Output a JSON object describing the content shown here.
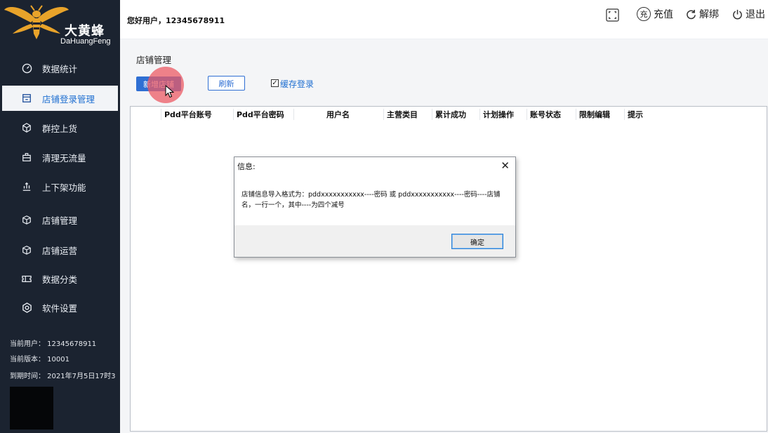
{
  "brand": {
    "name_cn": "大黄蜂",
    "name_en": "DaHuangFeng"
  },
  "sidebar": {
    "items": [
      {
        "label": "数据统计",
        "icon": "dashboard-icon",
        "active": false
      },
      {
        "label": "店铺登录管理",
        "icon": "store-icon",
        "active": true
      },
      {
        "label": "群控上货",
        "icon": "cube-icon",
        "active": false
      },
      {
        "label": "清理无流量",
        "icon": "briefcase-icon",
        "active": false
      },
      {
        "label": "上下架功能",
        "icon": "upload-chart-icon",
        "active": false
      },
      {
        "label": "店铺管理",
        "icon": "box-icon",
        "active": false
      },
      {
        "label": "店铺运营",
        "icon": "box-icon",
        "active": false
      },
      {
        "label": "数据分类",
        "icon": "ticket-icon",
        "active": false
      },
      {
        "label": "软件设置",
        "icon": "settings-hex-icon",
        "active": false
      }
    ],
    "current_user": "当前用户：  12345678911",
    "current_version": "当前版本：  10001",
    "expiry": "到期时间：  2021年7月5日17时3"
  },
  "header": {
    "greeting": "您好用户，12345678911",
    "recharge_label": "充值",
    "recharge_icon_char": "充",
    "unbind_label": "解绑",
    "logout_label": "退出"
  },
  "main": {
    "section_title": "店铺管理",
    "add_store_label": "新增店铺",
    "refresh_label": "刷新",
    "cache_login_label": "缓存登录",
    "cache_login_checked": true,
    "table_headers": [
      "Pdd平台账号",
      "Pdd平台密码",
      "用户名",
      "主营类目",
      "累计成功",
      "计划操作",
      "账号状态",
      "限制编辑",
      "提示"
    ]
  },
  "dialog": {
    "title": "信息:",
    "close_glyph": "✕",
    "message_line1": "店铺信息导入格式为：pddxxxxxxxxxxx----密码 或 pddxxxxxxxxxxx----密码----店铺",
    "message_line2": "名，一行一个，其中----为四个减号",
    "ok_label": "确定"
  },
  "colors": {
    "sidebar_bg": "#1b2330",
    "accent": "#2f6fd3",
    "logo_gold": "#e8a32a"
  }
}
